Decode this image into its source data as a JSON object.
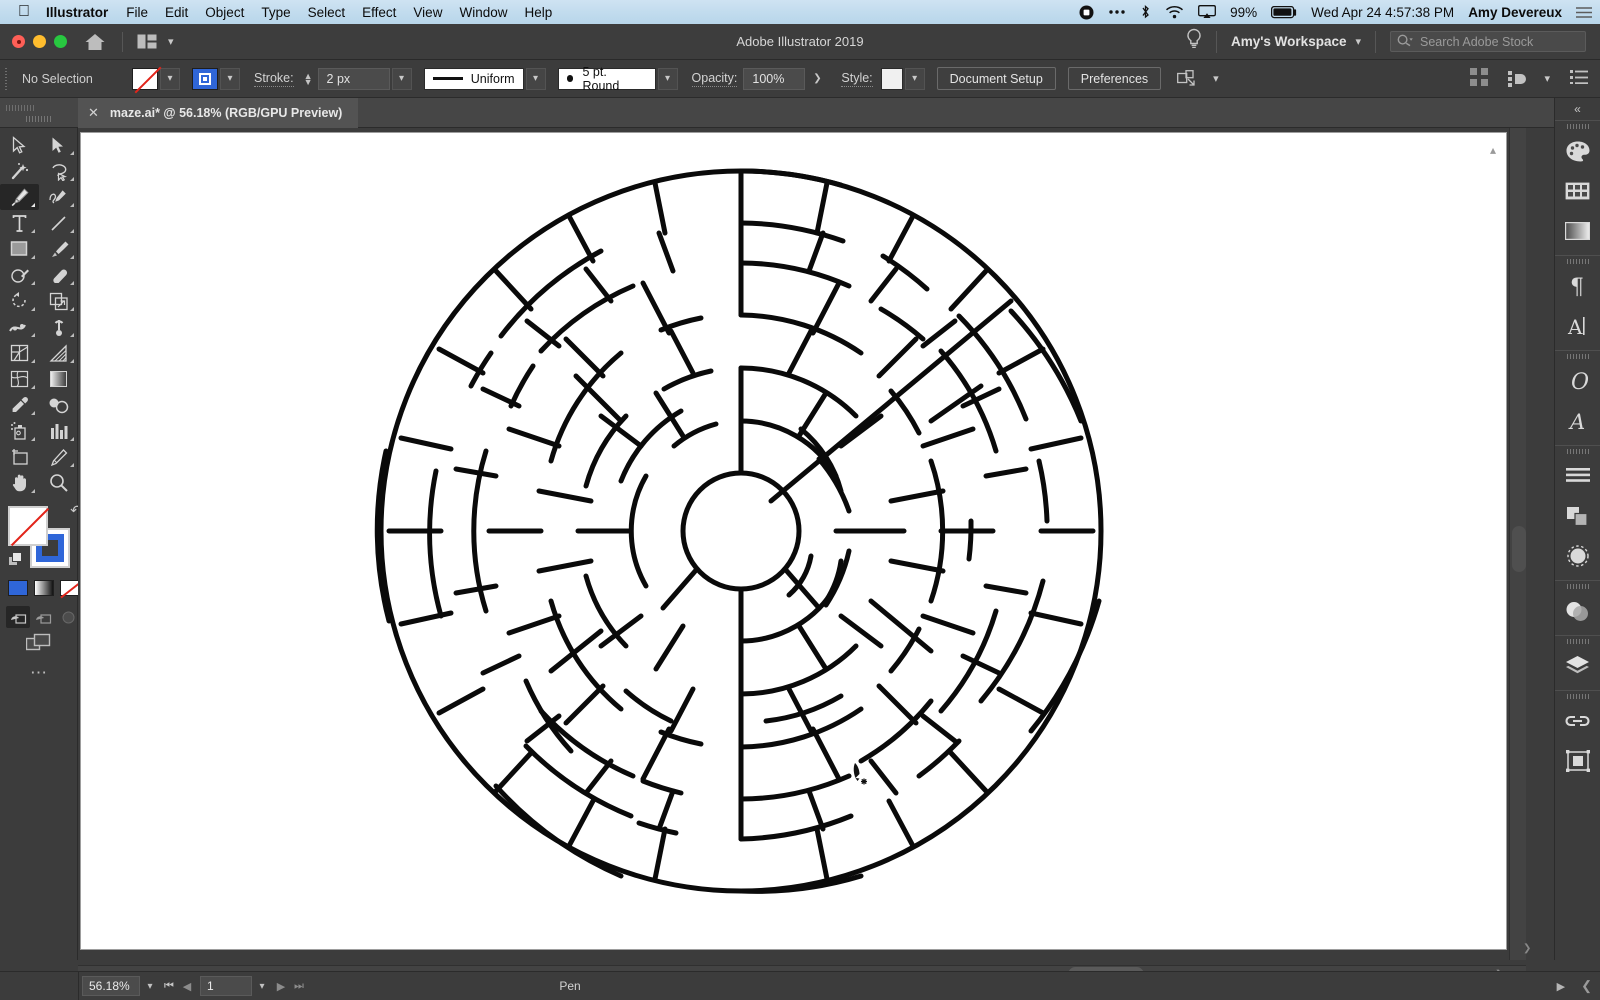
{
  "macbar": {
    "apple_icon": "apple-icon",
    "app_name": "Illustrator",
    "menus": [
      "File",
      "Edit",
      "Object",
      "Type",
      "Select",
      "Effect",
      "View",
      "Window",
      "Help"
    ],
    "status_icons": [
      "record-icon",
      "ellipsis-icon",
      "bluetooth-icon",
      "wifi-icon",
      "airplay-icon"
    ],
    "battery_percent": "99%",
    "battery_icon": "battery-icon",
    "datetime": "Wed Apr 24  4:57:38 PM",
    "user": "Amy Devereux",
    "control_center_icon": "control-center-icon"
  },
  "titlebar": {
    "app_title": "Adobe Illustrator 2019",
    "home_icon": "home-icon",
    "arrange_icon": "arrange-documents-icon",
    "arrange_chevron": "chevron-down-icon",
    "search_help_icon": "lightbulb-icon",
    "workspace": "Amy's Workspace",
    "workspace_chevron": "chevron-down-icon",
    "search_icon": "search-icon",
    "search_placeholder": "Search Adobe Stock"
  },
  "controlbar": {
    "selection_status": "No Selection",
    "fill_swatch": "none-fill-swatch",
    "fill_chevron": "chevron-down-icon",
    "stroke_swatch": "stroke-swatch",
    "stroke_chevron": "chevron-down-icon",
    "stroke_label": "Stroke:",
    "stroke_weight": "2 px",
    "stroke_weight_chevron": "chevron-down-icon",
    "variable_width_profile": "Uniform",
    "profile_chevron": "chevron-down-icon",
    "brush_definition": "5 pt. Round",
    "brush_chevron": "chevron-down-icon",
    "opacity_label": "Opacity:",
    "opacity_value": "100%",
    "opacity_arrow": "chevron-right-icon",
    "style_label": "Style:",
    "style_swatch": "graphic-style-swatch",
    "style_chevron": "chevron-down-icon",
    "document_setup": "Document Setup",
    "preferences": "Preferences",
    "transform_icon": "transform-icon",
    "transform_chevron": "chevron-down-icon",
    "align_grid_icon": "align-grid-icon",
    "distribute_icon": "distribute-icon",
    "distribute_chevron": "chevron-down-icon",
    "panel_menu_icon": "panel-menu-icon"
  },
  "tab": {
    "close_icon": "close-icon",
    "title": "maze.ai* @ 56.18% (RGB/GPU Preview)"
  },
  "toolbar": {
    "tools": [
      {
        "name": "selection-tool",
        "selected": false
      },
      {
        "name": "direct-selection-tool",
        "selected": false
      },
      {
        "name": "magic-wand-tool",
        "selected": false
      },
      {
        "name": "lasso-tool",
        "selected": false
      },
      {
        "name": "pen-tool",
        "selected": true
      },
      {
        "name": "curvature-tool",
        "selected": false
      },
      {
        "name": "type-tool",
        "selected": false
      },
      {
        "name": "line-segment-tool",
        "selected": false
      },
      {
        "name": "rectangle-tool",
        "selected": false
      },
      {
        "name": "paintbrush-tool",
        "selected": false
      },
      {
        "name": "shaper-tool",
        "selected": false
      },
      {
        "name": "eraser-tool",
        "selected": false
      },
      {
        "name": "rotate-tool",
        "selected": false
      },
      {
        "name": "scale-tool",
        "selected": false
      },
      {
        "name": "width-tool",
        "selected": false
      },
      {
        "name": "free-transform-tool",
        "selected": false
      },
      {
        "name": "shape-builder-tool",
        "selected": false
      },
      {
        "name": "perspective-grid-tool",
        "selected": false
      },
      {
        "name": "mesh-tool",
        "selected": false
      },
      {
        "name": "gradient-tool",
        "selected": false
      },
      {
        "name": "eyedropper-tool",
        "selected": false
      },
      {
        "name": "blend-tool",
        "selected": false
      },
      {
        "name": "symbol-sprayer-tool",
        "selected": false
      },
      {
        "name": "column-graph-tool",
        "selected": false
      },
      {
        "name": "artboard-tool",
        "selected": false
      },
      {
        "name": "slice-tool",
        "selected": false
      },
      {
        "name": "hand-tool",
        "selected": false
      },
      {
        "name": "zoom-tool",
        "selected": false
      }
    ],
    "fill_swatch": "fill-none-swatch",
    "stroke_swatch": "stroke-blue-swatch",
    "swap_icon": "swap-fill-stroke-icon",
    "default_icon": "default-fill-stroke-icon",
    "color_modes": [
      "color-swatch",
      "gradient-swatch",
      "none-swatch"
    ],
    "screen_modes": [
      "normal-screen-mode",
      "full-screen-menubar-mode",
      "full-screen-mode"
    ],
    "arrange_icon": "arrange-documents-icon",
    "more_icon": "edit-toolbar-icon"
  },
  "rightdock": {
    "collapse_icon": "collapse-panels-icon",
    "panels": [
      [
        "color-panel-icon",
        "swatches-panel-icon",
        "gradient-panel-icon"
      ],
      [
        "paragraph-panel-icon",
        "character-panel-icon"
      ],
      [
        "glyphs-panel-icon",
        "character-styles-panel-icon"
      ],
      [
        "align-panel-icon",
        "pathfinder-panel-icon",
        "transform-panel-icon"
      ],
      [
        "transparency-panel-icon"
      ],
      [
        "layers-panel-icon"
      ],
      [
        "links-panel-icon",
        "artboards-panel-icon"
      ]
    ]
  },
  "statusbar": {
    "zoom_level": "56.18%",
    "zoom_chevron": "chevron-down-icon",
    "first_page_icon": "first-artboard-icon",
    "prev_page_icon": "previous-artboard-icon",
    "page_number": "1",
    "page_chevron": "chevron-down-icon",
    "next_page_icon": "next-artboard-icon",
    "last_page_icon": "last-artboard-icon",
    "current_tool": "Pen",
    "status_arrow_icon": "status-menu-icon",
    "resize_icon": "resize-grip-icon"
  },
  "artwork": {
    "name": "circular-maze",
    "cursor": "pen-tool-cursor",
    "stroke_color": "#000000",
    "background": "#ffffff",
    "description": "Radial concentric-ring maze with central circular goal"
  },
  "colors": {
    "menubar_bg": "#c2dcee",
    "chrome_bg": "#3c3c3c",
    "panel_bg": "#464646",
    "accent_blue": "#2f66d8",
    "canvas_white": "#ffffff",
    "text_light": "#d0d0d0",
    "stroke_red": "#e2241a"
  }
}
